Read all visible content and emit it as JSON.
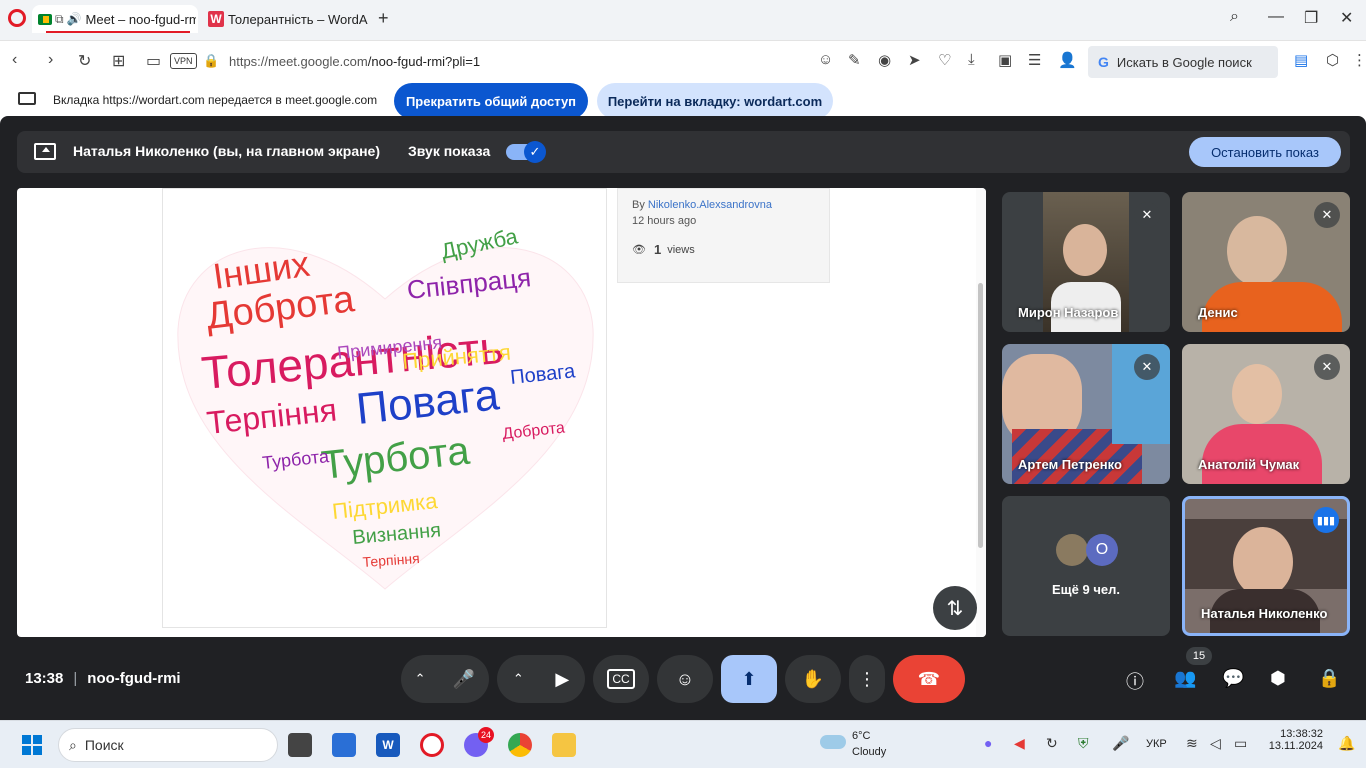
{
  "browser": {
    "tabs": [
      {
        "label": "Meet – noo-fgud-rmi"
      },
      {
        "label": "Толерантність – WordArt.com"
      }
    ],
    "url_host": "https://meet.google.com",
    "url_path": "/noo-fgud-rmi?pli=1",
    "search_box": "Искать в Google поиск"
  },
  "share_bar": {
    "message": "Вкладка https://wordart.com передается в meet.google.com",
    "stop_button": "Прекратить общий доступ",
    "goto_button": "Перейти на вкладку: wordart.com"
  },
  "presentation_bar": {
    "presenter": "Наталья Николенко (вы, на главном экране)",
    "sound_label": "Звук показа",
    "stop_show_button": "Остановить показ"
  },
  "wordart": {
    "by_prefix": "By ",
    "author": "Nikolenko.Alexsandrovna",
    "ago": "12 hours ago",
    "views_count": "1",
    "views_label": "views"
  },
  "participants": [
    {
      "name": "Мирон Назаров"
    },
    {
      "name": "Денис"
    },
    {
      "name": "Артем Петренко"
    },
    {
      "name": "Анатолій Чумак"
    }
  ],
  "more_participants": {
    "avatar_letter": "O",
    "label": "Ещё 9 чел."
  },
  "self_tile": {
    "name": "Наталья Николенко"
  },
  "meeting": {
    "time": "13:38",
    "code": "noo-fgud-rmi",
    "people_count": "15"
  },
  "taskbar": {
    "search_placeholder": "Поиск",
    "viber_badge": "24",
    "temperature": "6°C",
    "weather": "Cloudy",
    "lang": "УКР",
    "time": "13:38:32",
    "date": "13.11.2024"
  },
  "colors": {
    "meet_bg": "#202124",
    "primary_blue": "#0b57d0",
    "end_call_red": "#ea4335",
    "active_share": "#a8c7fa"
  }
}
